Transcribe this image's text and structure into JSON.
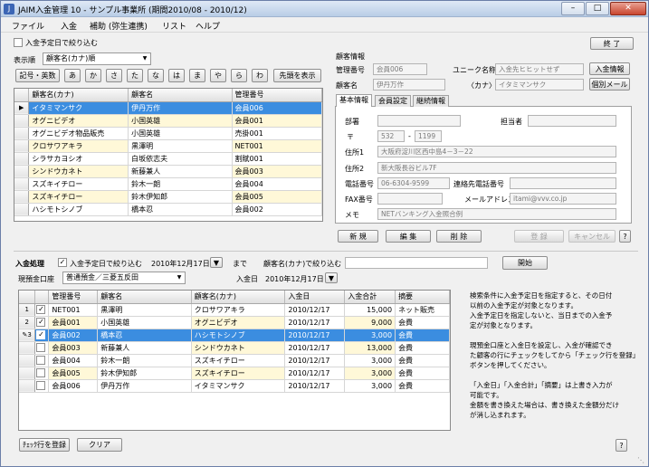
{
  "window": {
    "title": "JAIM入金管理 10 - サンプル事業所 (期間2010/08 - 2010/12)",
    "app_icon": "J"
  },
  "menu": [
    "ファイル",
    "入金",
    "補助 (弥生連携)",
    "リスト",
    "ヘルプ"
  ],
  "top": {
    "filter_label": "入金予定日で絞り込む",
    "end_label": "終 了"
  },
  "customer_list": {
    "sort_label": "表示順",
    "sort_value": "顧客名(カナ)順",
    "kana_buttons": [
      "記号・英数",
      "あ",
      "か",
      "さ",
      "た",
      "な",
      "は",
      "ま",
      "や",
      "ら",
      "わ",
      "先頭を表示"
    ],
    "headers": [
      "顧客名(カナ)",
      "顧客名",
      "管理番号"
    ],
    "rows": [
      {
        "kana": "イタミマンサク",
        "name": "伊丹万作",
        "id": "会員006"
      },
      {
        "kana": "オグニビデオ",
        "name": "小国英雄",
        "id": "会員001"
      },
      {
        "kana": "オグニビデオ物品販売",
        "name": "小国英雄",
        "id": "売掛001"
      },
      {
        "kana": "クロサワアキラ",
        "name": "黒澤明",
        "id": "NET001"
      },
      {
        "kana": "シラサカヨシオ",
        "name": "白坂依志夫",
        "id": "割賦001"
      },
      {
        "kana": "シンドウカネト",
        "name": "新藤兼人",
        "id": "会員003"
      },
      {
        "kana": "スズキイチロー",
        "name": "鈴木一朗",
        "id": "会員004"
      },
      {
        "kana": "スズキイチロー",
        "name": "鈴木伊知郎",
        "id": "会員005"
      },
      {
        "kana": "ハシモトシノブ",
        "name": "橋本忍",
        "id": "会員002"
      }
    ]
  },
  "customer_info": {
    "section_label": "顧客情報",
    "mgmt_label": "管理番号",
    "mgmt_value": "会員006",
    "unique_label": "ユニーク名称",
    "unique_value": "入金先ヒヒットせず",
    "entry_button": "入金情報",
    "name_label": "顧客名",
    "name_value": "伊丹万作",
    "kana_label": "〈カナ〉",
    "kana_value": "イタミマンサク",
    "mail_button": "個別メール",
    "tabs": [
      "基本情報",
      "会員設定",
      "継続情報"
    ],
    "dept_label": "部署",
    "person_label": "担当者",
    "zip_label": "〒",
    "zip1": "532",
    "zip2": "1199",
    "addr1_label": "住所1",
    "addr1_value": "大阪府淀川区西中島4－3－22",
    "addr2_label": "住所2",
    "addr2_value": "新大阪長谷ビル7F",
    "phone_label": "電話番号",
    "phone_value": "06-6304-9599",
    "contact_label": "連絡先電話番号",
    "fax_label": "FAX番号",
    "email_label": "メールアドレス",
    "email_value": "itami@vvv.co.jp",
    "memo_label": "メモ",
    "memo_value": "NETバンキング入金照合例",
    "buttons": {
      "new": "新 規",
      "edit": "編 集",
      "delete": "削 除",
      "register": "登 録",
      "cancel": "キャンセル",
      "help": "?"
    }
  },
  "payment": {
    "section_label": "入金処理",
    "filter_label": "入金予定日で絞り込む",
    "date_value": "2010年12月17日",
    "until_label": "まで",
    "kana_filter_label": "顧客名(カナ)で絞り込む",
    "start_button": "開始",
    "account_label": "現預金口座",
    "account_value": "普通預金／三菱五反田",
    "entry_date_label": "入金日",
    "entry_date_value": "2010年12月17日",
    "headers": [
      "管理番号",
      "顧客名",
      "顧客名(カナ)",
      "入金日",
      "入金合計",
      "摘要"
    ],
    "rows": [
      {
        "no": "1",
        "checked": true,
        "id": "NET001",
        "name": "黒澤明",
        "kana": "クロサワアキラ",
        "date": "2010/12/17",
        "amount": "15,000",
        "memo": "ネット販売"
      },
      {
        "no": "2",
        "checked": true,
        "id": "会員001",
        "name": "小国英雄",
        "kana": "オグニビデオ",
        "date": "2010/12/17",
        "amount": "9,000",
        "memo": "会費"
      },
      {
        "no": "3",
        "checked": true,
        "id": "会員002",
        "name": "橋本忍",
        "kana": "ハシモトシノブ",
        "date": "2010/12/17",
        "amount": "3,000",
        "memo": "会費"
      },
      {
        "no": "",
        "checked": false,
        "id": "会員003",
        "name": "新藤兼人",
        "kana": "シンドウカネト",
        "date": "2010/12/17",
        "amount": "13,000",
        "memo": "会費"
      },
      {
        "no": "",
        "checked": false,
        "id": "会員004",
        "name": "鈴木一朗",
        "kana": "スズキイチロー",
        "date": "2010/12/17",
        "amount": "3,000",
        "memo": "会費"
      },
      {
        "no": "",
        "checked": false,
        "id": "会員005",
        "name": "鈴木伊知郎",
        "kana": "スズキイチロー",
        "date": "2010/12/17",
        "amount": "3,000",
        "memo": "会費"
      },
      {
        "no": "",
        "checked": false,
        "id": "会員006",
        "name": "伊丹万作",
        "kana": "イタミマンサク",
        "date": "2010/12/17",
        "amount": "3,000",
        "memo": "会費"
      }
    ],
    "register_button": "ﾁｪｯｸ行を登録",
    "clear_button": "クリア",
    "help_button": "?"
  },
  "help_text": {
    "p1": [
      "検索条件に入金予定日を指定すると、その日付",
      "以前の入金予定が対象となります。",
      "入金予定日を指定しないと、当日までの入金予",
      "定が対象となります。"
    ],
    "p2": [
      "現預金口座と入金日を設定し、入金が確認でき",
      "た顧客の行にチェックをしてから「チェック行を登録」",
      "ボタンを押してください。"
    ],
    "p3": [
      "「入金日」「入金合計」「摘要」は上書き入力が",
      "可能です。",
      "金額を書き換えた場合は、書き換えた金額分だけ",
      "が消し込まれます。"
    ]
  }
}
